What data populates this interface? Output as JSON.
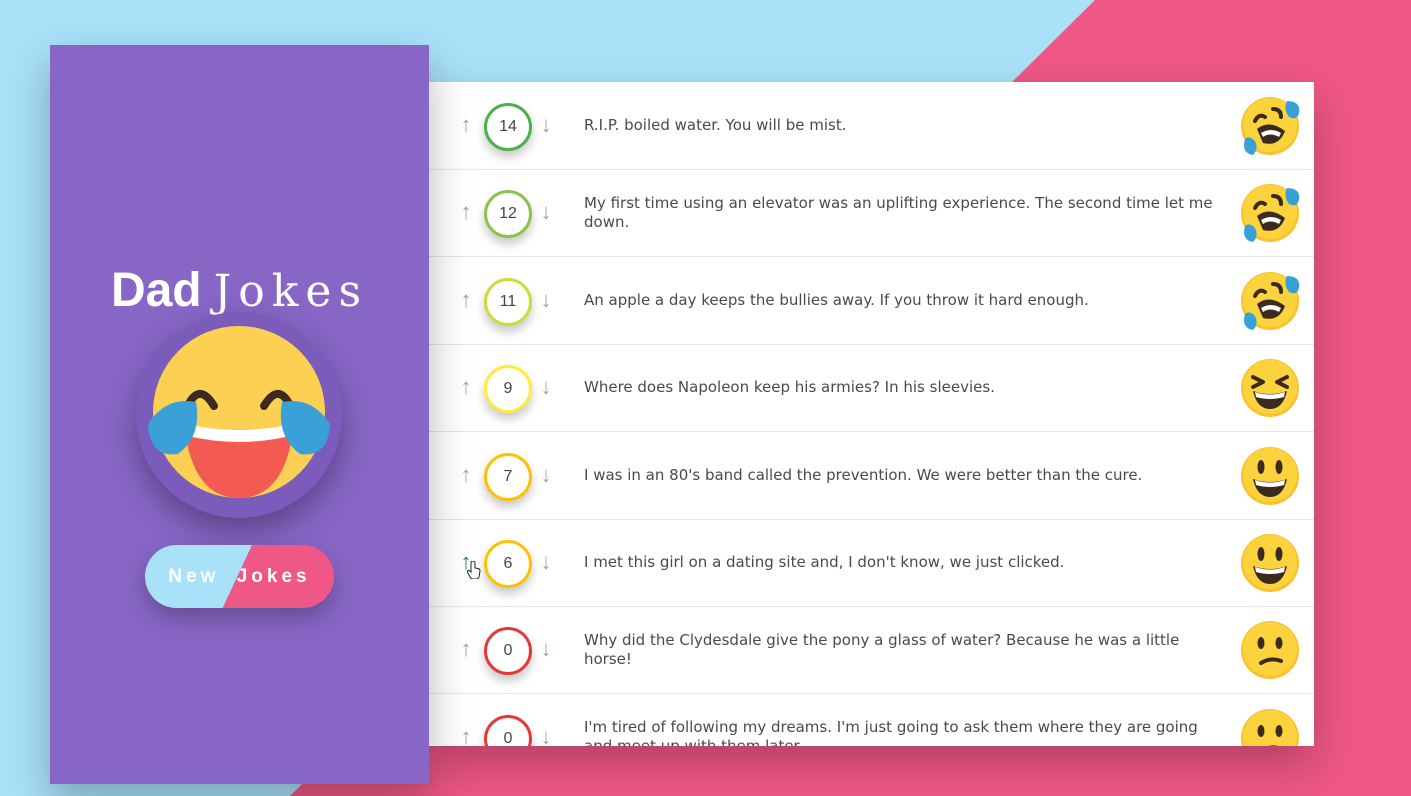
{
  "app": {
    "title_dad": "Dad",
    "title_jokes": "Jokes",
    "new_jokes_button": "New Jokes",
    "colors": {
      "purple": "#8766c6",
      "blue": "#a9e1f9",
      "pink": "#ef5786"
    }
  },
  "jokes": [
    {
      "votes": "14",
      "text": "R.I.P. boiled water. You will be mist.",
      "border": "#4caf50",
      "emoji": "rofl-emoji"
    },
    {
      "votes": "12",
      "text": "My first time using an elevator was an uplifting experience. The second time let me down.",
      "border": "#8bc34a",
      "emoji": "rofl-emoji"
    },
    {
      "votes": "11",
      "text": "An apple a day keeps the bullies away. If you throw it hard enough.",
      "border": "#cddc39",
      "emoji": "rofl-emoji"
    },
    {
      "votes": "9",
      "text": "Where does Napoleon keep his armies? In his sleevies.",
      "border": "#ffeb3b",
      "emoji": "squint-laugh-emoji"
    },
    {
      "votes": "7",
      "text": "I was in an 80's band called the prevention. We were better than the cure.",
      "border": "#ffc107",
      "emoji": "grin-emoji"
    },
    {
      "votes": "6",
      "text": "I met this girl on a dating site and, I don't know, we just clicked.",
      "border": "#ffc107",
      "emoji": "grin-emoji"
    },
    {
      "votes": "0",
      "text": "Why did the Clydesdale give the pony a glass of water? Because he was a little horse!",
      "border": "#e53935",
      "emoji": "confused-emoji"
    },
    {
      "votes": "0",
      "text": "I'm tired of following my dreams. I'm just going to ask them where they are going and meet up with them later.",
      "border": "#e53935",
      "emoji": "confused-emoji"
    }
  ]
}
